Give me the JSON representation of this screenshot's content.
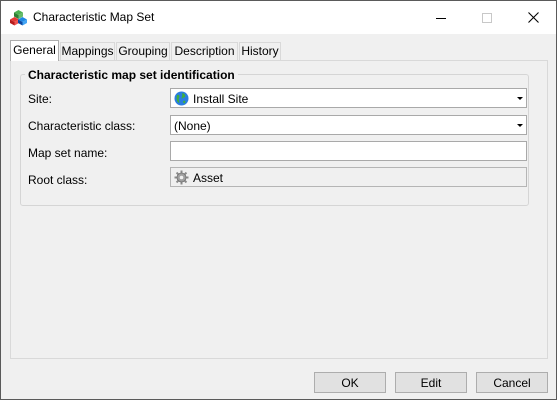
{
  "window": {
    "title": "Characteristic Map Set",
    "icon": "multicolor-cubes-icon"
  },
  "tabs": [
    {
      "label": "General",
      "active": true
    },
    {
      "label": "Mappings",
      "active": false
    },
    {
      "label": "Grouping",
      "active": false
    },
    {
      "label": "Description",
      "active": false
    },
    {
      "label": "History",
      "active": false
    }
  ],
  "general": {
    "group_title": "Characteristic map set identification",
    "site": {
      "label": "Site:",
      "value": "Install Site",
      "icon": "globe-icon"
    },
    "characteristic_class": {
      "label": "Characteristic class:",
      "value": "(None)"
    },
    "map_set_name": {
      "label": "Map set name:",
      "value": ""
    },
    "root_class": {
      "label": "Root class:",
      "value": "Asset",
      "icon": "gear-icon"
    }
  },
  "buttons": {
    "ok": "OK",
    "edit": "Edit",
    "cancel": "Cancel"
  }
}
